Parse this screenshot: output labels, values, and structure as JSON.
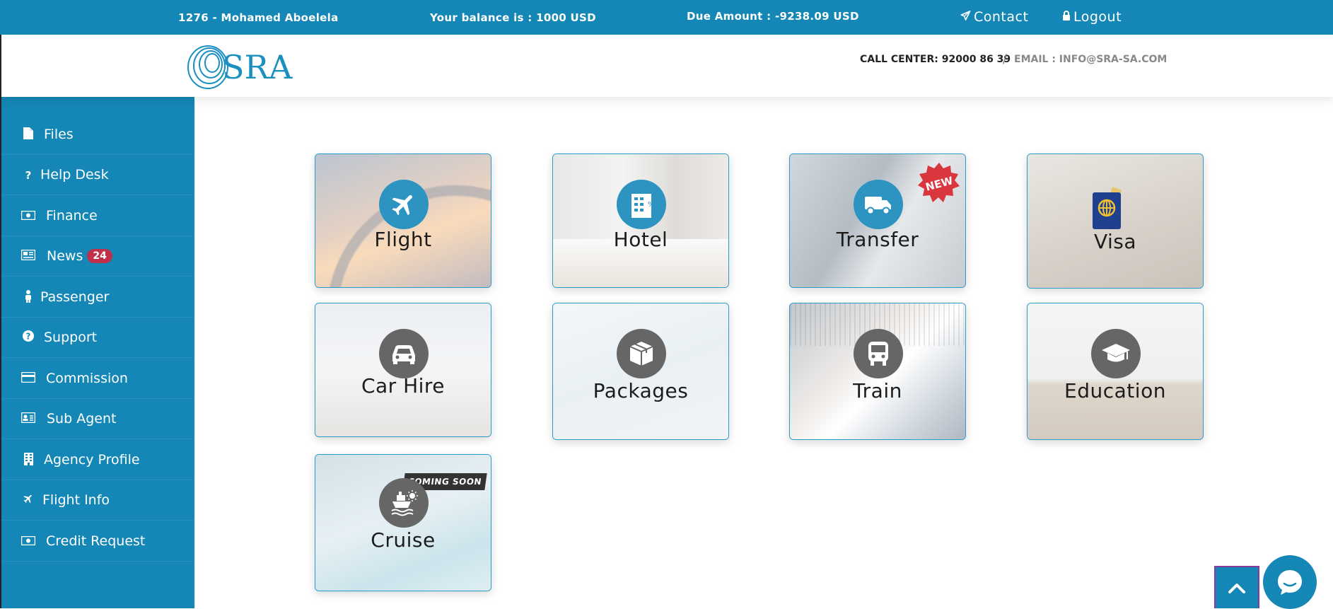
{
  "topbar": {
    "user": "1276 - Mohamed Aboelela",
    "balance": "Your balance is : 1000 USD",
    "due": "Due Amount : -9238.09 USD",
    "contact": "Contact",
    "logout": "Logout"
  },
  "header": {
    "logo_text": "SRA",
    "call_center": "CALL CENTER: 92000 86 39",
    "separator": "/",
    "email": "EMAIL : INFO@SRA-SA.COM"
  },
  "sidebar": {
    "items": [
      {
        "label": "Files",
        "icon": "file-icon"
      },
      {
        "label": "Help Desk",
        "icon": "question-icon"
      },
      {
        "label": "Finance",
        "icon": "money-icon"
      },
      {
        "label": "News",
        "icon": "newspaper-icon",
        "badge": "24"
      },
      {
        "label": "Passenger",
        "icon": "person-icon"
      },
      {
        "label": "Support",
        "icon": "question-circle-icon"
      },
      {
        "label": "Commission",
        "icon": "credit-card-icon"
      },
      {
        "label": "Sub Agent",
        "icon": "id-card-icon"
      },
      {
        "label": "Agency Profile",
        "icon": "building-icon"
      },
      {
        "label": "Flight Info",
        "icon": "plane-icon"
      },
      {
        "label": "Credit Request",
        "icon": "money-icon"
      }
    ]
  },
  "services": {
    "flight": "Flight",
    "hotel": "Hotel",
    "transfer": "Transfer",
    "transfer_badge": "NEW",
    "visa": "Visa",
    "car_hire": "Car Hire",
    "packages": "Packages",
    "train": "Train",
    "education": "Education",
    "cruise": "Cruise",
    "cruise_badge": "COMING SOON"
  },
  "colors": {
    "primary": "#1487b6",
    "circle_active": "#2d93c0",
    "circle_inactive": "#666666",
    "badge": "#c0304a"
  }
}
